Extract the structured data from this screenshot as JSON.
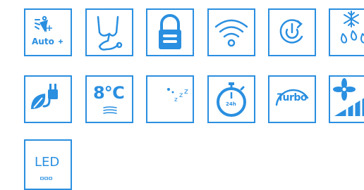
{
  "theme": {
    "accent": "#2a8fe0",
    "background": "#ffffff"
  },
  "tiles": [
    {
      "icon": "auto-mode-icon",
      "label": "Auto"
    },
    {
      "icon": "sterilize-icon"
    },
    {
      "icon": "lock-icon"
    },
    {
      "icon": "wifi-icon"
    },
    {
      "icon": "power-icon"
    },
    {
      "icon": "defrost-icon"
    },
    {
      "icon": "eco-plug-icon"
    },
    {
      "icon": "temperature-icon",
      "label": "8℃"
    },
    {
      "icon": "sleep-icon",
      "label": "z z z"
    },
    {
      "icon": "timer-icon",
      "label": "24h"
    },
    {
      "icon": "turbo-icon",
      "label": "Turbo"
    },
    {
      "icon": "fan-speed-icon"
    },
    {
      "icon": "led-icon",
      "label": "LED"
    }
  ],
  "sleep_letters": [
    "z",
    "z",
    "z"
  ]
}
